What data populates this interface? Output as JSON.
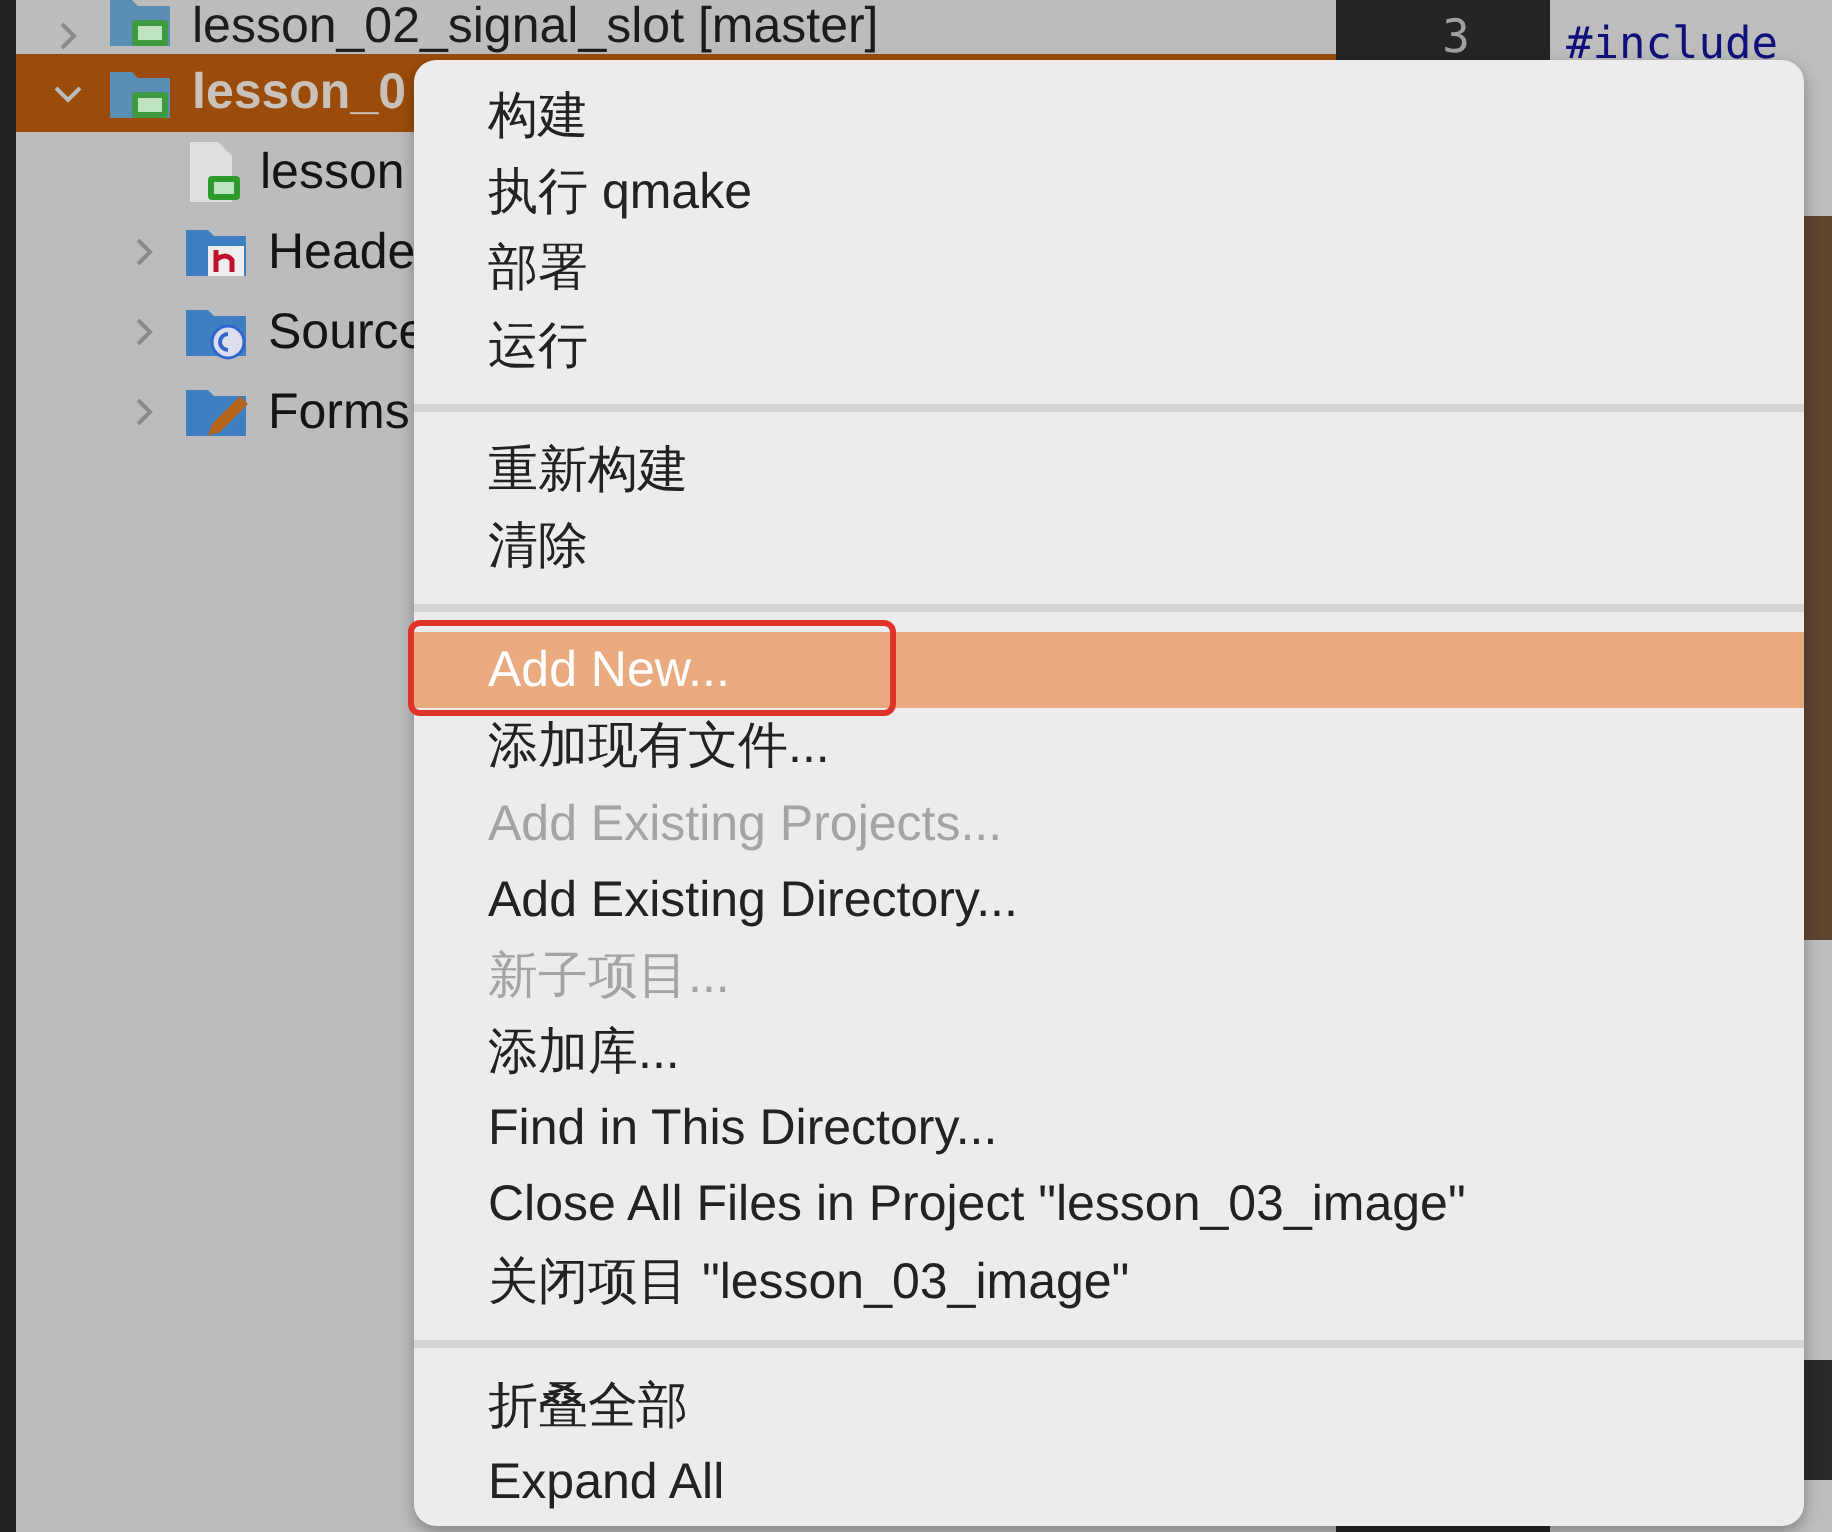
{
  "project_tree": [
    {
      "label": "lesson_02_signal_slot [master]",
      "expanded": false,
      "selected": false
    },
    {
      "label": "lesson_0",
      "expanded": true,
      "selected": true,
      "children": [
        {
          "label": "lesson",
          "selected": false
        },
        {
          "label": "Heade",
          "expanded": false,
          "selected": false
        },
        {
          "label": "Source",
          "expanded": false,
          "selected": false
        },
        {
          "label": "Forms",
          "expanded": false,
          "selected": false
        }
      ]
    }
  ],
  "editor": {
    "line_number": "3",
    "lines": [
      "#include"
    ]
  },
  "context_menu": {
    "groups": [
      [
        {
          "label": "构建",
          "disabled": false,
          "selected": false
        },
        {
          "label": "执行 qmake",
          "disabled": false,
          "selected": false
        },
        {
          "label": "部署",
          "disabled": false,
          "selected": false
        },
        {
          "label": "运行",
          "disabled": false,
          "selected": false
        }
      ],
      [
        {
          "label": "重新构建",
          "disabled": false,
          "selected": false
        },
        {
          "label": "清除",
          "disabled": false,
          "selected": false
        }
      ],
      [
        {
          "label": "Add New...",
          "disabled": false,
          "selected": true,
          "outlined": true
        },
        {
          "label": "添加现有文件...",
          "disabled": false,
          "selected": false
        },
        {
          "label": "Add Existing Projects...",
          "disabled": true,
          "selected": false
        },
        {
          "label": "Add Existing Directory...",
          "disabled": false,
          "selected": false
        },
        {
          "label": "新子项目...",
          "disabled": true,
          "selected": false
        },
        {
          "label": "添加库...",
          "disabled": false,
          "selected": false
        },
        {
          "label": "Find in This Directory...",
          "disabled": false,
          "selected": false
        },
        {
          "label": "Close All Files in Project \"lesson_03_image\"",
          "disabled": false,
          "selected": false
        },
        {
          "label": "关闭项目 \"lesson_03_image\"",
          "disabled": false,
          "selected": false
        }
      ],
      [
        {
          "label": "折叠全部",
          "disabled": false,
          "selected": false
        },
        {
          "label": "Expand All",
          "disabled": false,
          "selected": false
        }
      ]
    ]
  }
}
